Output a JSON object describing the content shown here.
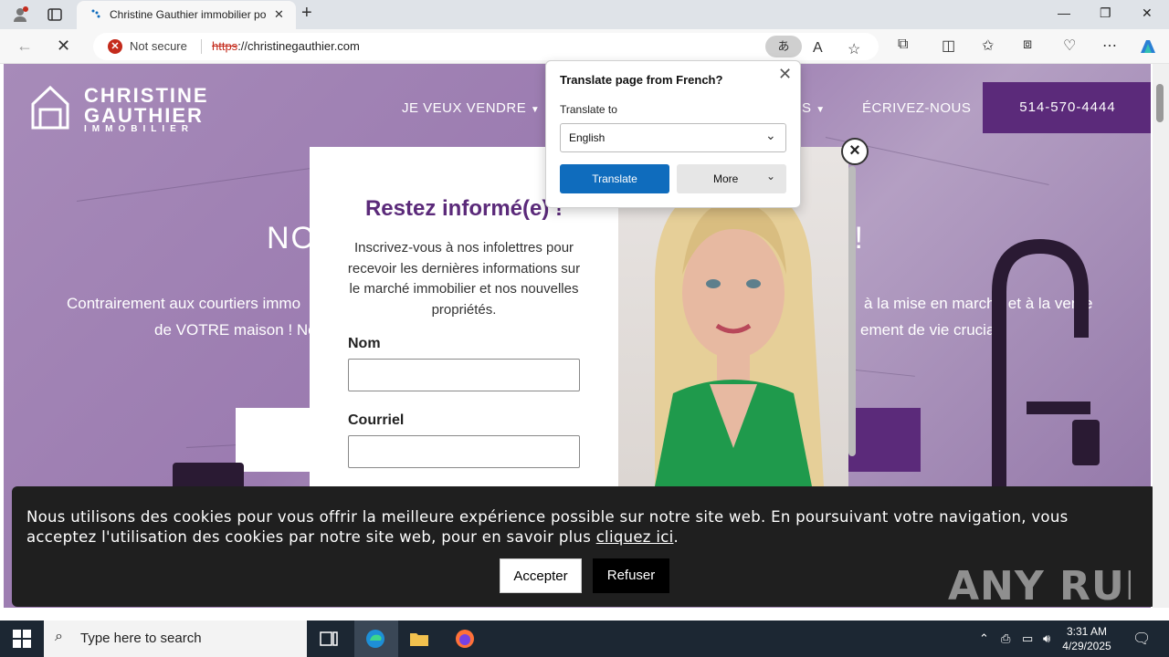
{
  "browser": {
    "tab_title": "Christine Gauthier immobilier po",
    "not_secure": "Not secure",
    "url_scheme": "https",
    "url_rest": "://christinegauthier.com",
    "translate_icon": "あ"
  },
  "site": {
    "logo_line1": "CHRISTINE",
    "logo_line2": "GAUTHIER",
    "logo_sub": "IMMOBILIER",
    "nav": [
      "JE VEUX VENDRE",
      "S",
      "ÉCRIVEZ-NOUS"
    ],
    "phone": "514-570-4444",
    "hero_title_left": "NOT",
    "hero_title_right": "N!",
    "hero_line1_left": "Contrairement aux courtiers immo",
    "hero_line1_right": "à la mise en marché et à la vente",
    "hero_line2_left": "de VOTRE maison ! Nou",
    "hero_line2_right": "ement de vie crucial."
  },
  "modal": {
    "title": "Restez informé(e) !",
    "description": "Inscrivez-vous à nos infolettres pour recevoir les dernières informations sur le marché immobilier et nos nouvelles propriétés.",
    "name_label": "Nom",
    "email_label": "Courriel",
    "close": "×"
  },
  "translate": {
    "title": "Translate page from French?",
    "label": "Translate to",
    "language": "English",
    "translate_btn": "Translate",
    "more_btn": "More"
  },
  "cookie": {
    "text_before": "Nous utilisons des cookies pour vous offrir la meilleure expérience possible sur notre site web. En poursuivant votre navigation, vous acceptez l'utilisation des cookies par notre site web, pour en savoir plus ",
    "link": "cliquez ici",
    "text_after": ".",
    "accept": "Accepter",
    "refuse": "Refuser",
    "watermark": "ANY RUN"
  },
  "taskbar": {
    "search_placeholder": "Type here to search",
    "time": "3:31 AM",
    "date": "4/29/2025"
  }
}
